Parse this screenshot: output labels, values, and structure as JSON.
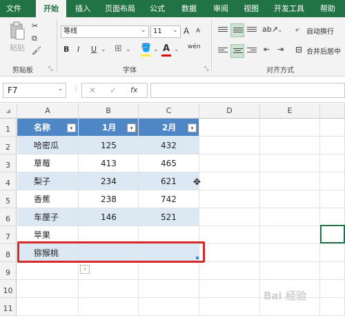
{
  "ribbon_tabs": [
    "文件",
    "开始",
    "插入",
    "页面布局",
    "公式",
    "数据",
    "审阅",
    "视图",
    "开发工具",
    "帮助"
  ],
  "clipboard": {
    "paste_label": "粘贴",
    "group_label": "剪贴板"
  },
  "font": {
    "name": "等线",
    "size": "11",
    "group_label": "字体",
    "bold": "B",
    "italic": "I",
    "underline": "U",
    "grow": "A",
    "shrink": "A",
    "color_letter": "A",
    "phonetic": "wén"
  },
  "alignment": {
    "wrap_text": "自动换行",
    "merge_center": "合并后居中",
    "group_label": "对齐方式"
  },
  "formula_bar": {
    "cell_ref": "F7",
    "cancel": "✕",
    "enter": "✓",
    "fx": "fx",
    "content": ""
  },
  "columns": [
    "A",
    "B",
    "C",
    "D",
    "E"
  ],
  "rows": [
    "1",
    "2",
    "3",
    "4",
    "5",
    "6",
    "7",
    "8",
    "9",
    "10",
    "11"
  ],
  "table": {
    "headers": [
      "名称",
      "1月",
      "2月"
    ],
    "rows": [
      [
        "哈密瓜",
        "125",
        "432"
      ],
      [
        "草莓",
        "413",
        "465"
      ],
      [
        "梨子",
        "234",
        "621"
      ],
      [
        "香蕉",
        "238",
        "742"
      ],
      [
        "车厘子",
        "146",
        "521"
      ],
      [
        "苹果",
        "",
        ""
      ],
      [
        "猕猴桃",
        "",
        ""
      ]
    ]
  },
  "colors": {
    "excel_green": "#217346",
    "table_header": "#4f86c6",
    "table_band": "#dde8f5",
    "highlight_red": "#d62828"
  },
  "watermark": "Bai 经验"
}
